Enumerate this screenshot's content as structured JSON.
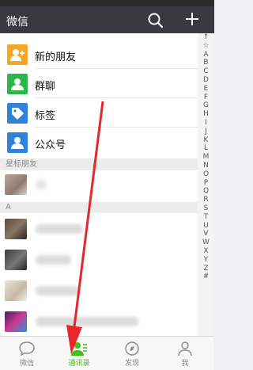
{
  "header": {
    "title": "微信",
    "search_icon": "search-icon",
    "add_icon": "plus-icon"
  },
  "fixed_items": [
    {
      "label": "新的朋友",
      "icon": "new-friends-icon",
      "color": "#f5a623"
    },
    {
      "label": "群聊",
      "icon": "group-chat-icon",
      "color": "#2ab649"
    },
    {
      "label": "标签",
      "icon": "tag-icon",
      "color": "#2e82d8"
    },
    {
      "label": "公众号",
      "icon": "official-account-icon",
      "color": "#2e82d8"
    }
  ],
  "sections": {
    "starred": "星标朋友",
    "a": "A"
  },
  "index_letters": [
    "↑",
    "☆",
    "A",
    "B",
    "C",
    "D",
    "E",
    "F",
    "G",
    "H",
    "I",
    "J",
    "K",
    "L",
    "M",
    "N",
    "O",
    "P",
    "Q",
    "R",
    "S",
    "T",
    "U",
    "V",
    "W",
    "X",
    "Y",
    "Z",
    "#"
  ],
  "tabs": [
    {
      "label": "微信",
      "icon": "chat-bubble-icon"
    },
    {
      "label": "通讯录",
      "icon": "contacts-icon",
      "active": true
    },
    {
      "label": "发现",
      "icon": "compass-icon"
    },
    {
      "label": "我",
      "icon": "person-icon"
    }
  ],
  "colors": {
    "topbar": "#393a3f",
    "accent_green": "#45c01a",
    "arrow": "#e8262b"
  }
}
